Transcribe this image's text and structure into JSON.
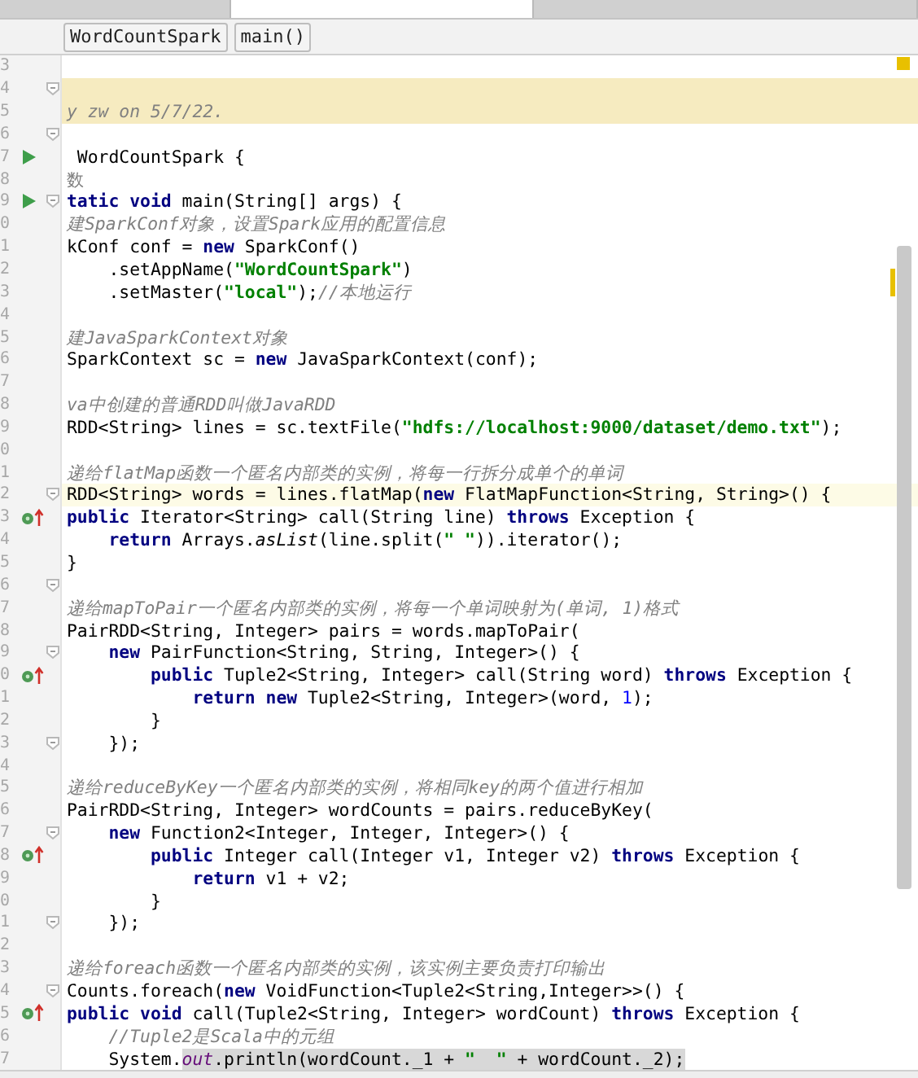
{
  "tabs": [
    {
      "selected": false
    },
    {
      "selected": true
    },
    {
      "selected": false
    }
  ],
  "breadcrumbs": [
    "WordCountSpark",
    "main()"
  ],
  "lines": [
    {
      "num": "3",
      "kind": "code",
      "fold": false
    },
    {
      "num": "4",
      "kind": "doc",
      "fold": true
    },
    {
      "num": "5",
      "kind": "doc",
      "fold": false,
      "tokens": [
        {
          "kind": "cmt",
          "text": "y zw on 5/7/22."
        }
      ]
    },
    {
      "num": "6",
      "kind": "code",
      "fold": true
    },
    {
      "num": "7",
      "kind": "code",
      "fold": false,
      "gutter_icons": [
        {
          "kind": "run"
        }
      ],
      "tokens": [
        {
          "kind": "p",
          "text": " WordCountSpark {"
        }
      ]
    },
    {
      "num": "8",
      "kind": "code",
      "fold": false,
      "tokens": [
        {
          "kind": "cmtn",
          "text": "数"
        }
      ]
    },
    {
      "num": "9",
      "kind": "code",
      "fold": true,
      "gutter_icons": [
        {
          "kind": "run"
        }
      ],
      "tokens": [
        {
          "kind": "kw",
          "text": "tatic void"
        },
        {
          "kind": "p",
          "text": " main(String[] args) {"
        }
      ]
    },
    {
      "num": "0",
      "kind": "code",
      "fold": false,
      "tokens": [
        {
          "kind": "cmt",
          "text": "建SparkConf对象，设置Spark应用的配置信息"
        }
      ]
    },
    {
      "num": "1",
      "kind": "code",
      "fold": false,
      "tokens": [
        {
          "kind": "p",
          "text": "kConf conf = "
        },
        {
          "kind": "kw",
          "text": "new"
        },
        {
          "kind": "p",
          "text": " SparkConf()"
        }
      ]
    },
    {
      "num": "2",
      "kind": "code",
      "fold": false,
      "tokens": [
        {
          "kind": "p",
          "text": "    .setAppName("
        },
        {
          "kind": "str",
          "text": "\"WordCountSpark\""
        },
        {
          "kind": "p",
          "text": ")"
        }
      ]
    },
    {
      "num": "3",
      "kind": "code",
      "fold": false,
      "tokens": [
        {
          "kind": "p",
          "text": "    .setMaster("
        },
        {
          "kind": "str",
          "text": "\"local\""
        },
        {
          "kind": "p",
          "text": ");"
        },
        {
          "kind": "cmt",
          "text": "//本地运行"
        }
      ]
    },
    {
      "num": "4",
      "kind": "code",
      "fold": false
    },
    {
      "num": "5",
      "kind": "code",
      "fold": false,
      "tokens": [
        {
          "kind": "cmt",
          "text": "建JavaSparkContext对象"
        }
      ]
    },
    {
      "num": "6",
      "kind": "code",
      "fold": false,
      "tokens": [
        {
          "kind": "p",
          "text": "SparkContext sc = "
        },
        {
          "kind": "kw",
          "text": "new"
        },
        {
          "kind": "p",
          "text": " JavaSparkContext(conf);"
        }
      ]
    },
    {
      "num": "7",
      "kind": "code",
      "fold": false
    },
    {
      "num": "8",
      "kind": "code",
      "fold": false,
      "tokens": [
        {
          "kind": "cmt",
          "text": "va中创建的普通RDD叫做JavaRDD"
        }
      ]
    },
    {
      "num": "9",
      "kind": "code",
      "fold": false,
      "tokens": [
        {
          "kind": "p",
          "text": "RDD<String> lines = sc.textFile("
        },
        {
          "kind": "str",
          "text": "\"hdfs://localhost:9000/dataset/demo.txt\""
        },
        {
          "kind": "p",
          "text": ");"
        }
      ]
    },
    {
      "num": "0",
      "kind": "code",
      "fold": false
    },
    {
      "num": "1",
      "kind": "code",
      "fold": false,
      "tokens": [
        {
          "kind": "cmt",
          "text": "递给flatMap函数一个匿名内部类的实例，将每一行拆分成单个的单词"
        }
      ]
    },
    {
      "num": "2",
      "kind": "current",
      "fold": true,
      "tokens": [
        {
          "kind": "p",
          "text": "RDD<String> words = lines.flatMap("
        },
        {
          "kind": "kw",
          "text": "new"
        },
        {
          "kind": "p",
          "text": " FlatMapFunction<String, String>() {"
        }
      ]
    },
    {
      "num": "3",
      "kind": "code",
      "fold": false,
      "gutter_icons": [
        {
          "kind": "override"
        }
      ],
      "tokens": [
        {
          "kind": "kw",
          "text": "public"
        },
        {
          "kind": "p",
          "text": " Iterator<String> call(String line) "
        },
        {
          "kind": "kw",
          "text": "throws"
        },
        {
          "kind": "p",
          "text": " Exception {"
        }
      ]
    },
    {
      "num": "4",
      "kind": "code",
      "fold": false,
      "tokens": [
        {
          "kind": "kw",
          "text": "    return"
        },
        {
          "kind": "p",
          "text": " Arrays."
        },
        {
          "kind": "it",
          "text": "asList"
        },
        {
          "kind": "p",
          "text": "(line.split("
        },
        {
          "kind": "str",
          "text": "\" \""
        },
        {
          "kind": "p",
          "text": ")).iterator();"
        }
      ]
    },
    {
      "num": "5",
      "kind": "code",
      "fold": false,
      "tokens": [
        {
          "kind": "p",
          "text": "}"
        }
      ]
    },
    {
      "num": "6",
      "kind": "code",
      "fold": true
    },
    {
      "num": "7",
      "kind": "code",
      "fold": false,
      "tokens": [
        {
          "kind": "cmt",
          "text": "递给mapToPair一个匿名内部类的实例，将每一个单词映射为(单词, 1)格式"
        }
      ]
    },
    {
      "num": "8",
      "kind": "code",
      "fold": false,
      "tokens": [
        {
          "kind": "p",
          "text": "PairRDD<String, Integer> pairs = words.mapToPair("
        }
      ]
    },
    {
      "num": "9",
      "kind": "code",
      "fold": true,
      "tokens": [
        {
          "kind": "kw",
          "text": "    new"
        },
        {
          "kind": "p",
          "text": " PairFunction<String, String, Integer>() {"
        }
      ]
    },
    {
      "num": "0",
      "kind": "code",
      "fold": false,
      "gutter_icons": [
        {
          "kind": "override"
        }
      ],
      "tokens": [
        {
          "kind": "kw",
          "text": "        public"
        },
        {
          "kind": "p",
          "text": " Tuple2<String, Integer> call(String word) "
        },
        {
          "kind": "kw",
          "text": "throws"
        },
        {
          "kind": "p",
          "text": " Exception {"
        }
      ]
    },
    {
      "num": "1",
      "kind": "code",
      "fold": false,
      "tokens": [
        {
          "kind": "kw",
          "text": "            return new"
        },
        {
          "kind": "p",
          "text": " Tuple2<String, Integer>(word, "
        },
        {
          "kind": "num",
          "text": "1"
        },
        {
          "kind": "p",
          "text": ");"
        }
      ]
    },
    {
      "num": "2",
      "kind": "code",
      "fold": false,
      "tokens": [
        {
          "kind": "p",
          "text": "        }"
        }
      ]
    },
    {
      "num": "3",
      "kind": "code",
      "fold": true,
      "tokens": [
        {
          "kind": "p",
          "text": "    });"
        }
      ]
    },
    {
      "num": "4",
      "kind": "code",
      "fold": false
    },
    {
      "num": "5",
      "kind": "code",
      "fold": false,
      "tokens": [
        {
          "kind": "cmt",
          "text": "递给reduceByKey一个匿名内部类的实例，将相同key的两个值进行相加"
        }
      ]
    },
    {
      "num": "6",
      "kind": "code",
      "fold": false,
      "tokens": [
        {
          "kind": "p",
          "text": "PairRDD<String, Integer> wordCounts = pairs.reduceByKey("
        }
      ]
    },
    {
      "num": "7",
      "kind": "code",
      "fold": true,
      "tokens": [
        {
          "kind": "kw",
          "text": "    new"
        },
        {
          "kind": "p",
          "text": " Function2<Integer, Integer, Integer>() {"
        }
      ]
    },
    {
      "num": "8",
      "kind": "code",
      "fold": false,
      "gutter_icons": [
        {
          "kind": "override"
        }
      ],
      "tokens": [
        {
          "kind": "kw",
          "text": "        public"
        },
        {
          "kind": "p",
          "text": " Integer call(Integer v1, Integer v2) "
        },
        {
          "kind": "kw",
          "text": "throws"
        },
        {
          "kind": "p",
          "text": " Exception {"
        }
      ]
    },
    {
      "num": "9",
      "kind": "code",
      "fold": false,
      "tokens": [
        {
          "kind": "kw",
          "text": "            return"
        },
        {
          "kind": "p",
          "text": " v1 + v2;"
        }
      ]
    },
    {
      "num": "0",
      "kind": "code",
      "fold": false,
      "tokens": [
        {
          "kind": "p",
          "text": "        }"
        }
      ]
    },
    {
      "num": "1",
      "kind": "code",
      "fold": true,
      "tokens": [
        {
          "kind": "p",
          "text": "    });"
        }
      ]
    },
    {
      "num": "2",
      "kind": "code",
      "fold": false
    },
    {
      "num": "3",
      "kind": "code",
      "fold": false,
      "tokens": [
        {
          "kind": "cmt",
          "text": "递给foreach函数一个匿名内部类的实例，该实例主要负责打印输出"
        }
      ]
    },
    {
      "num": "4",
      "kind": "code",
      "fold": true,
      "tokens": [
        {
          "kind": "p",
          "text": "Counts.foreach("
        },
        {
          "kind": "kw",
          "text": "new"
        },
        {
          "kind": "p",
          "text": " VoidFunction<Tuple2<String,Integer>>() {"
        }
      ]
    },
    {
      "num": "5",
      "kind": "code",
      "fold": false,
      "gutter_icons": [
        {
          "kind": "override"
        }
      ],
      "tokens": [
        {
          "kind": "kw",
          "text": "public void"
        },
        {
          "kind": "p",
          "text": " call(Tuple2<String, Integer> wordCount) "
        },
        {
          "kind": "kw",
          "text": "throws"
        },
        {
          "kind": "p",
          "text": " Exception {"
        }
      ]
    },
    {
      "num": "6",
      "kind": "code",
      "fold": false,
      "tokens": [
        {
          "kind": "cmt",
          "text": "    //Tuple2是Scala中的元组"
        }
      ]
    },
    {
      "num": "7",
      "kind": "code",
      "fold": false,
      "tokens": [
        {
          "kind": "p",
          "text": "    System."
        },
        {
          "kind": "field",
          "text": "out",
          "shaded": true
        },
        {
          "kind": "p",
          "text": ".println(wordCount._1 + ",
          "shaded": true
        },
        {
          "kind": "str",
          "text": "\"  \"",
          "shaded": true
        },
        {
          "kind": "p",
          "text": " + wordCount._2);",
          "shaded": true
        }
      ]
    }
  ]
}
